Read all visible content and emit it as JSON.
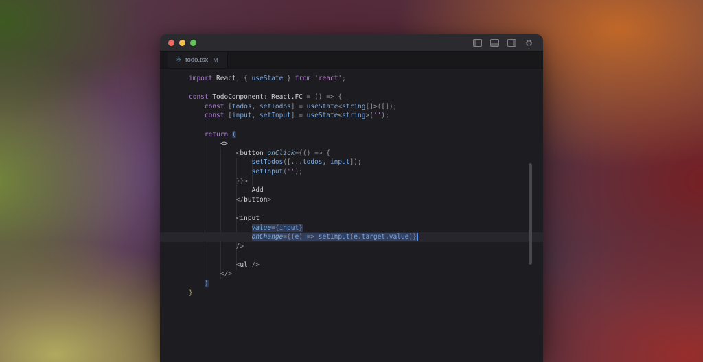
{
  "window": {
    "kind": "code-editor-window"
  },
  "titlebar": {
    "traffic_lights": [
      {
        "name": "close",
        "color": "#ec6a5e"
      },
      {
        "name": "minimize",
        "color": "#f4bf4f"
      },
      {
        "name": "zoom",
        "color": "#61c454"
      }
    ],
    "right_icons": [
      "panel-left-icon",
      "panel-bottom-icon",
      "panel-right-icon",
      "settings-gear-icon"
    ]
  },
  "icons": {
    "tab_file_icon": "⚛",
    "settings_gear": "⚙"
  },
  "tab": {
    "name": "todo.tsx",
    "modified": "M"
  },
  "colors": {
    "editor_bg": "#1d1d21",
    "titlebar_bg": "#2b2b2f",
    "tabstrip_bg": "#18181b",
    "keyword": "#ad7cd9",
    "variable": "#78a7e0",
    "string": "#bd80cc",
    "selection": "#42609e",
    "current_line": "#26262c",
    "cursor": "#5a8fea"
  },
  "editor": {
    "language": "tsx",
    "current_line": 18,
    "guides": [
      {
        "ch": 4,
        "from": 4,
        "to": 23
      },
      {
        "ch": 8,
        "from": 9,
        "to": 22
      },
      {
        "ch": 12,
        "from": 10,
        "to": 21
      },
      {
        "ch": 16,
        "from": 10,
        "to": 12
      }
    ],
    "lines": [
      [
        [
          "k",
          "import "
        ],
        [
          "p",
          "React"
        ],
        [
          "u",
          ", { "
        ],
        [
          "v",
          "useState"
        ],
        [
          "u",
          " } "
        ],
        [
          "k",
          "from "
        ],
        [
          "s",
          "'react'"
        ],
        [
          "u",
          ";"
        ]
      ],
      [],
      [
        [
          "k",
          "const "
        ],
        [
          "p",
          "TodoComponent"
        ],
        [
          "u",
          ": "
        ],
        [
          "p",
          "React.FC"
        ],
        [
          "u",
          " = () => {"
        ]
      ],
      [
        [
          "u",
          "    "
        ],
        [
          "k",
          "const "
        ],
        [
          "u",
          "["
        ],
        [
          "v",
          "todos"
        ],
        [
          "u",
          ", "
        ],
        [
          "v",
          "setTodos"
        ],
        [
          "u",
          "] = "
        ],
        [
          "v",
          "useState"
        ],
        [
          "u",
          "<"
        ],
        [
          "v",
          "string"
        ],
        [
          "u",
          "[]>([]);"
        ]
      ],
      [
        [
          "u",
          "    "
        ],
        [
          "k",
          "const "
        ],
        [
          "u",
          "["
        ],
        [
          "v",
          "input"
        ],
        [
          "u",
          ", "
        ],
        [
          "v",
          "setInput"
        ],
        [
          "u",
          "] = "
        ],
        [
          "v",
          "useState"
        ],
        [
          "u",
          "<"
        ],
        [
          "v",
          "string"
        ],
        [
          "u",
          ">("
        ],
        [
          "s",
          "''"
        ],
        [
          "u",
          ");"
        ]
      ],
      [],
      [
        [
          "u",
          "    "
        ],
        [
          "k",
          "return "
        ],
        [
          "b",
          "("
        ]
      ],
      [
        [
          "p",
          "        <>"
        ]
      ],
      [
        [
          "p",
          "            "
        ],
        [
          "u",
          "<"
        ],
        [
          "p",
          "button "
        ],
        [
          "a",
          "onClick"
        ],
        [
          "u",
          "={() => {"
        ]
      ],
      [
        [
          "p",
          "                "
        ],
        [
          "v",
          "setTodos"
        ],
        [
          "u",
          "([..."
        ],
        [
          "v",
          "todos"
        ],
        [
          "u",
          ", "
        ],
        [
          "v",
          "input"
        ],
        [
          "u",
          "]);"
        ]
      ],
      [
        [
          "p",
          "                "
        ],
        [
          "v",
          "setInput"
        ],
        [
          "u",
          "("
        ],
        [
          "s",
          "''"
        ],
        [
          "u",
          ");"
        ]
      ],
      [
        [
          "p",
          "            "
        ],
        [
          "u",
          "}}>"
        ]
      ],
      [
        [
          "p",
          "                Add"
        ]
      ],
      [
        [
          "p",
          "            "
        ],
        [
          "u",
          "</"
        ],
        [
          "p",
          "button"
        ],
        [
          "u",
          ">"
        ]
      ],
      [],
      [
        [
          "p",
          "            "
        ],
        [
          "u",
          "<"
        ],
        [
          "p",
          "input"
        ]
      ],
      [
        [
          "p",
          "                "
        ],
        [
          "a",
          "value",
          "sel"
        ],
        [
          "u",
          "={",
          "sel"
        ],
        [
          "v",
          "input",
          "sel"
        ],
        [
          "u",
          "}",
          "sel"
        ]
      ],
      [
        [
          "p",
          "                "
        ],
        [
          "a",
          "onChange",
          "sel"
        ],
        [
          "u",
          "={(",
          "sel"
        ],
        [
          "v",
          "e",
          "sel"
        ],
        [
          "u",
          ") => ",
          "sel"
        ],
        [
          "v",
          "setInput",
          "sel"
        ],
        [
          "u",
          "(",
          "sel"
        ],
        [
          "v",
          "e.target.value",
          "sel"
        ],
        [
          "u",
          ")}",
          "sel"
        ],
        [
          "cursor",
          ""
        ]
      ],
      [
        [
          "p",
          "            "
        ],
        [
          "u",
          "/>"
        ]
      ],
      [],
      [
        [
          "p",
          "            "
        ],
        [
          "u",
          "<"
        ],
        [
          "p",
          "ul"
        ],
        [
          "u",
          " />"
        ]
      ],
      [
        [
          "p",
          "        "
        ],
        [
          "u",
          "</>"
        ]
      ],
      [
        [
          "u",
          "    "
        ],
        [
          "b",
          ")"
        ]
      ],
      [
        [
          "g",
          "}"
        ]
      ]
    ]
  }
}
